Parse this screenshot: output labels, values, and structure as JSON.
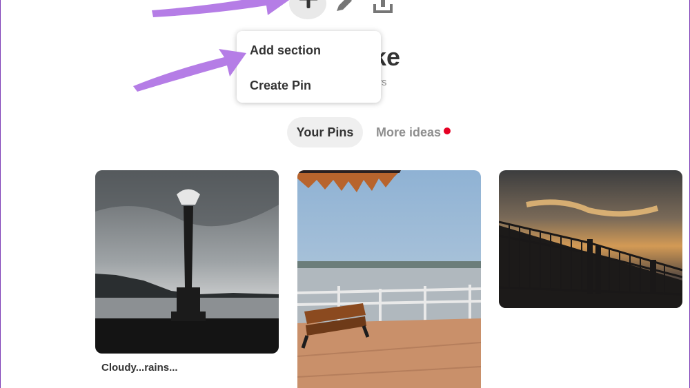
{
  "toolbar": {
    "icons": [
      "plus-icon",
      "pencil-icon",
      "share-icon"
    ]
  },
  "board": {
    "title_visible_fragment": "ke",
    "subtitle_visible_fragment": "rs"
  },
  "menu": {
    "items": [
      {
        "label": "Add section"
      },
      {
        "label": "Create Pin"
      }
    ]
  },
  "tabs": {
    "active": "Your Pins",
    "more": "More ideas",
    "notification_color": "#e60023"
  },
  "pins": [
    {
      "caption": "Cloudy...rains..."
    },
    {
      "caption": ""
    },
    {
      "caption": ""
    }
  ],
  "annotation_color": "#b57de6"
}
